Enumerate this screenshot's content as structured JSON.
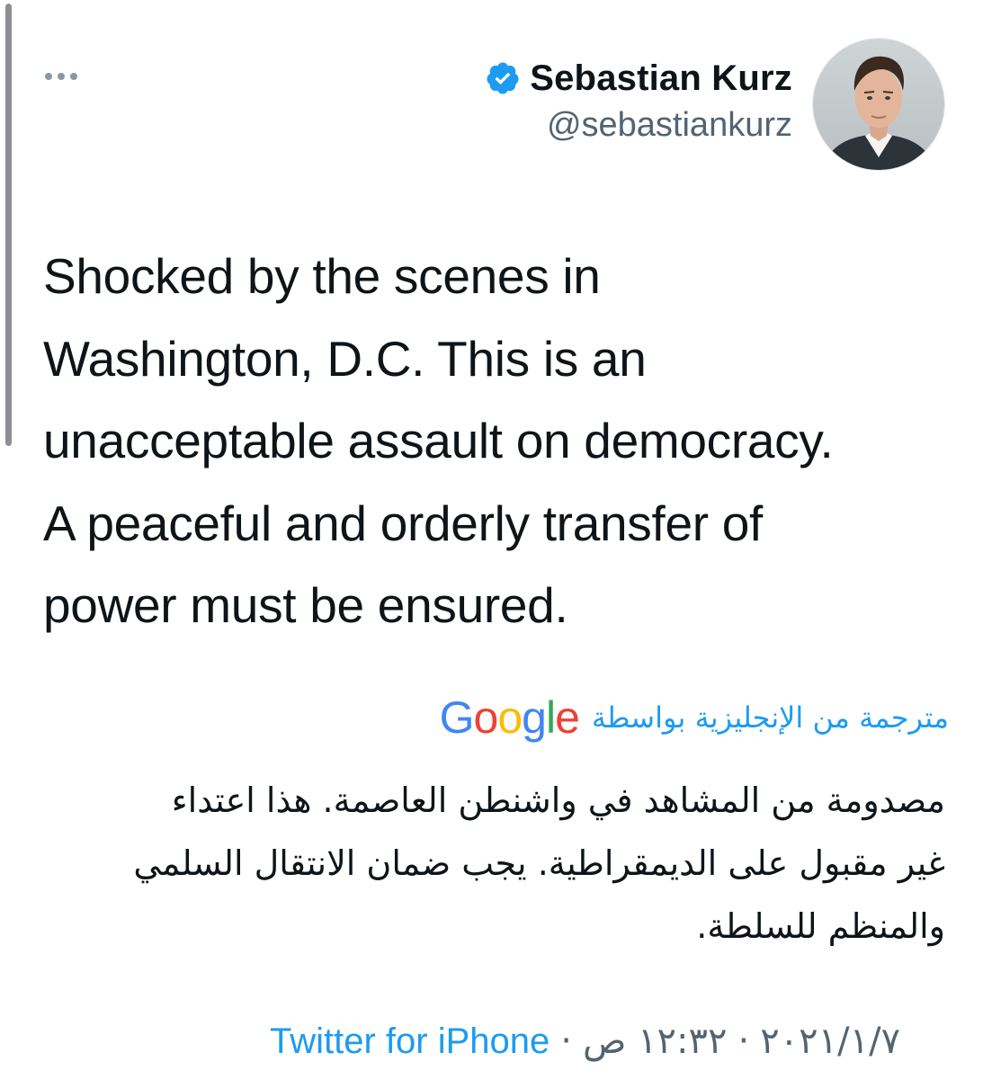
{
  "tweet": {
    "author": {
      "display_name": "Sebastian Kurz",
      "handle": "@sebastiankurz",
      "verified": true
    },
    "text_lines": [
      "Shocked by the scenes in",
      "Washington, D.C. This is an",
      "unacceptable assault on democracy.",
      "A peaceful and orderly transfer of",
      "power must be ensured."
    ],
    "translation": {
      "label": "مترجمة من الإنجليزية بواسطة",
      "provider": "Google",
      "text_lines": [
        "مصدومة من المشاهد في واشنطن العاصمة. هذا اعتداء",
        "غير مقبول على الديمقراطية. يجب ضمان الانتقال السلمي",
        "والمنظم للسلطة."
      ]
    },
    "meta": {
      "source": "Twitter for iPhone",
      "separator": "·",
      "time": "١٢:٣٢ ص",
      "date": "٢٠٢١/١/٧"
    }
  },
  "colors": {
    "accent": "#1d9bf0",
    "secondary_text": "#536471",
    "primary_text": "#0f1419",
    "google_blue": "#4285F4",
    "google_red": "#EA4335",
    "google_yellow": "#FBBC05",
    "google_green": "#34A853"
  },
  "icons": {
    "more": "more-horizontal-icon",
    "verified": "verified-badge-icon",
    "avatar": "profile-photo"
  }
}
